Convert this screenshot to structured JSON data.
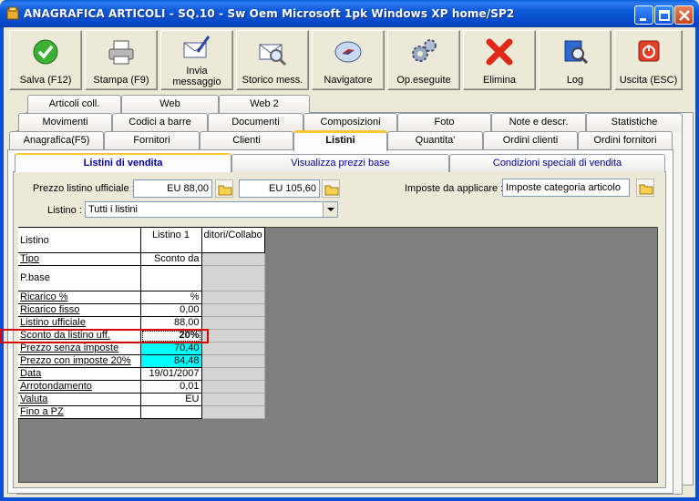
{
  "window": {
    "title": "ANAGRAFICA ARTICOLI - SQ.10 - Sw Oem Microsoft 1pk Windows XP home/SP2"
  },
  "toolbar": [
    {
      "label": "Salva (F12)",
      "icon": "check-icon"
    },
    {
      "label": "Stampa (F9)",
      "icon": "printer-icon"
    },
    {
      "label": "Invia messaggio",
      "icon": "envelope-pen-icon"
    },
    {
      "label": "Storico mess.",
      "icon": "envelope-search-icon"
    },
    {
      "label": "Navigatore",
      "icon": "compass-icon"
    },
    {
      "label": "Op.eseguite",
      "icon": "gears-icon"
    },
    {
      "label": "Elimina",
      "icon": "delete-x-icon"
    },
    {
      "label": "Log",
      "icon": "log-search-icon"
    },
    {
      "label": "Uscita (ESC)",
      "icon": "exit-icon"
    }
  ],
  "tabs": {
    "row1": [
      "Articoli coll.",
      "Web",
      "Web 2"
    ],
    "row2": [
      "Movimenti",
      "Codici a barre",
      "Documenti",
      "Composizioni",
      "Foto",
      "Note e descr.",
      "Statistiche"
    ],
    "row3": [
      "Anagrafica(F5)",
      "Fornitori",
      "Clienti",
      "Listini",
      "Quantita'",
      "Ordini clienti",
      "Ordini fornitori"
    ],
    "active": "Listini"
  },
  "subtabs": {
    "items": [
      "Listini di vendita",
      "Visualizza prezzi base",
      "Condizioni speciali di vendita"
    ],
    "active": "Listini di vendita"
  },
  "form": {
    "prezzo_label": "Prezzo listino ufficiale :",
    "prezzo_value": "EU 88,00",
    "prezzo_value2": "EU 105,60",
    "imposte_label": "Imposte da applicare :",
    "imposte_value": "Imposte categoria articolo",
    "listino_label": "Listino :",
    "listino_value": "Tutti i listini"
  },
  "grid": {
    "header": {
      "label": "Listino",
      "col1": "Listino 1",
      "col2": "ditori/Collabo"
    },
    "rows": [
      {
        "label": "Tipo",
        "value": "Sconto da"
      },
      {
        "label": "P.base",
        "value": ""
      },
      {
        "label": "Ricarico %",
        "value": "%"
      },
      {
        "label": "Ricarico fisso",
        "value": "0,00"
      },
      {
        "label": "Listino ufficiale",
        "value": "88,00"
      },
      {
        "label": "Sconto da listino uff.",
        "value": "20%"
      },
      {
        "label": "Prezzo senza imposte",
        "value": "70,40"
      },
      {
        "label": "Prezzo con imposte 20%",
        "value": "84,48"
      },
      {
        "label": "Data",
        "value": "19/01/2007"
      },
      {
        "label": "Arrotondamento",
        "value": "0,01"
      },
      {
        "label": "Valuta",
        "value": "EU"
      },
      {
        "label": "Fino a PZ",
        "value": ""
      }
    ]
  },
  "colors": {
    "titlebar": "#0a58d6",
    "highlight_cyan": "#00ffff",
    "selection_box": "#d80000",
    "subtab_text": "#00009c"
  }
}
